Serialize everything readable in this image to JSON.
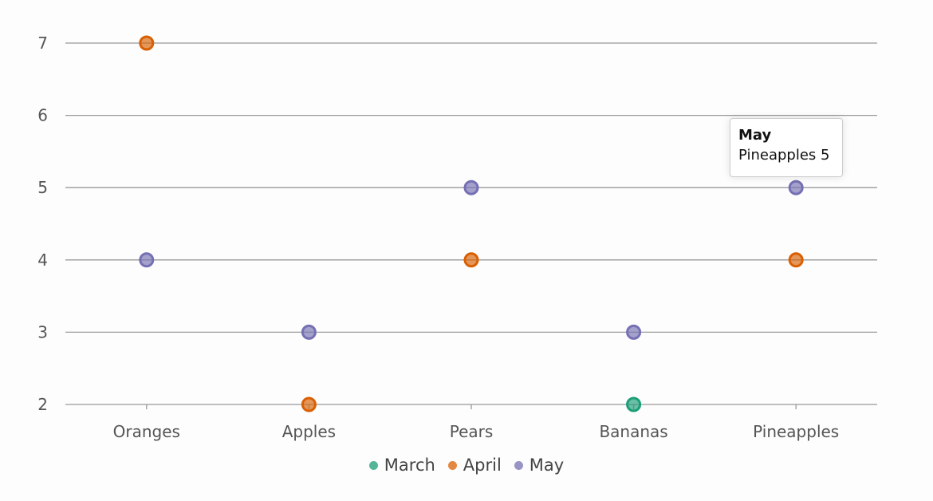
{
  "chart_data": {
    "type": "scatter",
    "title": "",
    "xlabel": "",
    "ylabel": "",
    "categories": [
      "Oranges",
      "Apples",
      "Pears",
      "Bananas",
      "Pineapples"
    ],
    "ylim": [
      2,
      7
    ],
    "yticks": [
      2,
      3,
      4,
      5,
      6,
      7
    ],
    "grid": true,
    "legend_placement": "bottom",
    "series": [
      {
        "name": "March",
        "color": "#1b9e77",
        "points": [
          {
            "x": "Bananas",
            "y": 2
          }
        ]
      },
      {
        "name": "April",
        "color": "#d95f02",
        "points": [
          {
            "x": "Oranges",
            "y": 7
          },
          {
            "x": "Apples",
            "y": 2
          },
          {
            "x": "Pears",
            "y": 4
          },
          {
            "x": "Pineapples",
            "y": 4
          }
        ]
      },
      {
        "name": "May",
        "color": "#7570b3",
        "points": [
          {
            "x": "Oranges",
            "y": 4
          },
          {
            "x": "Apples",
            "y": 3
          },
          {
            "x": "Pears",
            "y": 5
          },
          {
            "x": "Bananas",
            "y": 3
          },
          {
            "x": "Pineapples",
            "y": 5
          }
        ]
      }
    ],
    "tooltip": {
      "series": "May",
      "text": "Pineapples 5"
    }
  }
}
